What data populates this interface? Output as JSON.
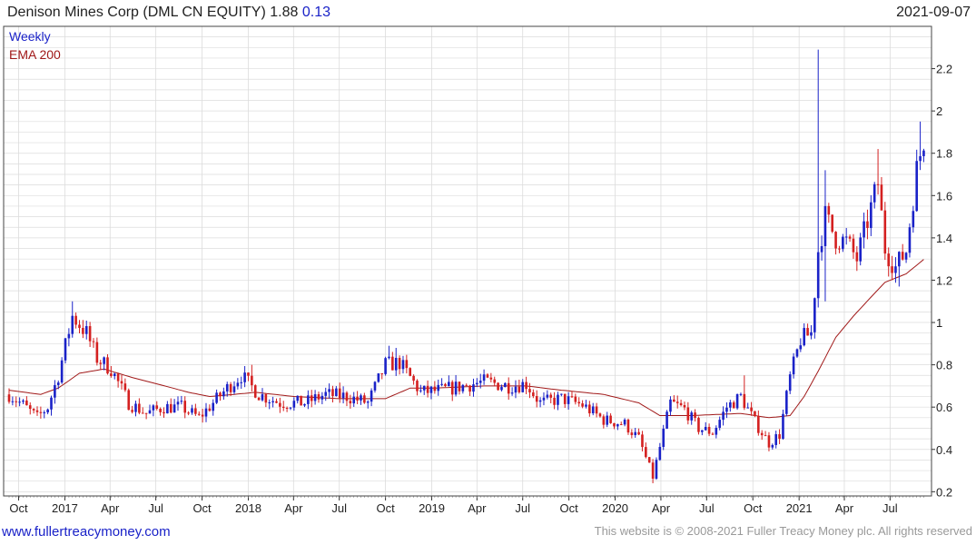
{
  "header": {
    "title": "Denison Mines Corp (DML CN EQUITY)",
    "last": "1.88",
    "change": "0.13",
    "date": "2021-09-07"
  },
  "footer": {
    "site": "www.fullertreacymoney.com",
    "copyright": "This website is © 2008-2021 Fuller Treacy Money plc. All rights reserved"
  },
  "colors": {
    "up": "#1a22c8",
    "down": "#d42020",
    "ema": "#a01818",
    "grid": "#dcdcdc",
    "legend_weekly": "#1a22c8",
    "legend_ema": "#a01818"
  },
  "chart_data": {
    "type": "candlestick",
    "legend": [
      "Weekly",
      "EMA 200"
    ],
    "legend_position": "top-left",
    "y_axis_side": "right",
    "grid": true,
    "ylim": [
      0.18,
      2.4
    ],
    "yticks": [
      "0.2",
      "0.4",
      "0.6",
      "0.8",
      "1",
      "1.2",
      "1.4",
      "1.6",
      "1.8",
      "2",
      "2.2"
    ],
    "xlim": [
      "2016-09-12",
      "2021-09-07"
    ],
    "xticks": [
      {
        "label": "Oct",
        "date": "2016-10-01"
      },
      {
        "label": "2017",
        "date": "2017-01-01"
      },
      {
        "label": "Apr",
        "date": "2017-04-01"
      },
      {
        "label": "Jul",
        "date": "2017-07-01"
      },
      {
        "label": "Oct",
        "date": "2017-10-01"
      },
      {
        "label": "2018",
        "date": "2018-01-01"
      },
      {
        "label": "Apr",
        "date": "2018-04-01"
      },
      {
        "label": "Jul",
        "date": "2018-07-01"
      },
      {
        "label": "Oct",
        "date": "2018-10-01"
      },
      {
        "label": "2019",
        "date": "2019-01-01"
      },
      {
        "label": "Apr",
        "date": "2019-04-01"
      },
      {
        "label": "Jul",
        "date": "2019-07-01"
      },
      {
        "label": "Oct",
        "date": "2019-10-01"
      },
      {
        "label": "2020",
        "date": "2020-01-01"
      },
      {
        "label": "Apr",
        "date": "2020-04-01"
      },
      {
        "label": "Jul",
        "date": "2020-07-01"
      },
      {
        "label": "Oct",
        "date": "2020-10-01"
      },
      {
        "label": "2021",
        "date": "2021-01-01"
      },
      {
        "label": "Apr",
        "date": "2021-04-01"
      },
      {
        "label": "Jul",
        "date": "2021-07-01"
      }
    ],
    "close_anchors": [
      [
        "2016-09-12",
        0.66
      ],
      [
        "2016-10-10",
        0.61
      ],
      [
        "2016-11-07",
        0.55
      ],
      [
        "2016-11-28",
        0.6
      ],
      [
        "2016-12-19",
        0.75
      ],
      [
        "2017-01-16",
        1.03
      ],
      [
        "2017-02-13",
        0.95
      ],
      [
        "2017-03-06",
        0.83
      ],
      [
        "2017-04-03",
        0.78
      ],
      [
        "2017-05-08",
        0.62
      ],
      [
        "2017-06-12",
        0.57
      ],
      [
        "2017-07-17",
        0.6
      ],
      [
        "2017-08-21",
        0.6
      ],
      [
        "2017-09-25",
        0.55
      ],
      [
        "2017-10-23",
        0.62
      ],
      [
        "2017-11-20",
        0.69
      ],
      [
        "2017-12-18",
        0.75
      ],
      [
        "2018-01-22",
        0.66
      ],
      [
        "2018-03-05",
        0.62
      ],
      [
        "2018-04-23",
        0.62
      ],
      [
        "2018-06-04",
        0.66
      ],
      [
        "2018-07-16",
        0.65
      ],
      [
        "2018-08-27",
        0.62
      ],
      [
        "2018-10-01",
        0.8
      ],
      [
        "2018-10-29",
        0.81
      ],
      [
        "2018-12-10",
        0.67
      ],
      [
        "2019-01-21",
        0.68
      ],
      [
        "2019-03-04",
        0.7
      ],
      [
        "2019-04-15",
        0.72
      ],
      [
        "2019-06-03",
        0.7
      ],
      [
        "2019-07-08",
        0.71
      ],
      [
        "2019-08-05",
        0.62
      ],
      [
        "2019-09-16",
        0.64
      ],
      [
        "2019-10-28",
        0.61
      ],
      [
        "2019-12-09",
        0.54
      ],
      [
        "2020-01-20",
        0.52
      ],
      [
        "2020-02-17",
        0.45
      ],
      [
        "2020-03-16",
        0.27
      ],
      [
        "2020-04-06",
        0.48
      ],
      [
        "2020-04-20",
        0.62
      ],
      [
        "2020-05-18",
        0.59
      ],
      [
        "2020-06-15",
        0.5
      ],
      [
        "2020-07-13",
        0.48
      ],
      [
        "2020-08-10",
        0.6
      ],
      [
        "2020-09-07",
        0.65
      ],
      [
        "2020-10-05",
        0.53
      ],
      [
        "2020-11-02",
        0.43
      ],
      [
        "2020-11-23",
        0.47
      ],
      [
        "2020-12-14",
        0.74
      ],
      [
        "2021-01-04",
        0.92
      ],
      [
        "2021-01-25",
        0.95
      ],
      [
        "2021-02-08",
        1.34
      ],
      [
        "2021-02-22",
        1.5
      ],
      [
        "2021-03-15",
        1.4
      ],
      [
        "2021-04-05",
        1.38
      ],
      [
        "2021-04-26",
        1.3
      ],
      [
        "2021-05-17",
        1.48
      ],
      [
        "2021-06-07",
        1.66
      ],
      [
        "2021-06-21",
        1.35
      ],
      [
        "2021-07-12",
        1.26
      ],
      [
        "2021-08-02",
        1.34
      ],
      [
        "2021-08-23",
        1.72
      ],
      [
        "2021-09-07",
        1.88
      ]
    ],
    "ema_anchors": [
      [
        "2016-09-12",
        0.68
      ],
      [
        "2016-11-14",
        0.66
      ],
      [
        "2016-12-19",
        0.69
      ],
      [
        "2017-01-30",
        0.76
      ],
      [
        "2017-03-20",
        0.78
      ],
      [
        "2017-05-15",
        0.74
      ],
      [
        "2017-07-03",
        0.71
      ],
      [
        "2017-09-04",
        0.67
      ],
      [
        "2017-10-16",
        0.65
      ],
      [
        "2017-12-04",
        0.66
      ],
      [
        "2018-01-15",
        0.67
      ],
      [
        "2018-04-02",
        0.65
      ],
      [
        "2018-07-02",
        0.64
      ],
      [
        "2018-10-01",
        0.64
      ],
      [
        "2018-11-19",
        0.69
      ],
      [
        "2019-01-07",
        0.69
      ],
      [
        "2019-04-15",
        0.7
      ],
      [
        "2019-07-08",
        0.7
      ],
      [
        "2019-09-16",
        0.68
      ],
      [
        "2019-12-09",
        0.66
      ],
      [
        "2020-02-17",
        0.62
      ],
      [
        "2020-03-30",
        0.56
      ],
      [
        "2020-06-01",
        0.56
      ],
      [
        "2020-09-07",
        0.57
      ],
      [
        "2020-11-02",
        0.55
      ],
      [
        "2020-12-14",
        0.56
      ],
      [
        "2021-01-11",
        0.65
      ],
      [
        "2021-02-08",
        0.77
      ],
      [
        "2021-03-15",
        0.93
      ],
      [
        "2021-04-19",
        1.03
      ],
      [
        "2021-05-24",
        1.12
      ],
      [
        "2021-06-21",
        1.19
      ],
      [
        "2021-08-02",
        1.23
      ],
      [
        "2021-09-07",
        1.3
      ]
    ],
    "spikes": [
      {
        "date": "2017-01-16",
        "high": 1.1
      },
      {
        "date": "2018-01-08",
        "high": 0.8
      },
      {
        "date": "2018-10-08",
        "high": 0.89
      },
      {
        "date": "2018-10-22",
        "high": 0.88
      },
      {
        "date": "2020-03-16",
        "low": 0.24
      },
      {
        "date": "2020-09-14",
        "high": 0.75
      },
      {
        "date": "2021-02-08",
        "high": 2.29,
        "low": 1.3
      },
      {
        "date": "2021-02-22",
        "high": 1.72,
        "low": 1.1
      },
      {
        "date": "2021-06-07",
        "high": 1.82
      },
      {
        "date": "2021-07-19",
        "low": 1.17
      },
      {
        "date": "2021-08-30",
        "high": 1.95
      }
    ]
  }
}
